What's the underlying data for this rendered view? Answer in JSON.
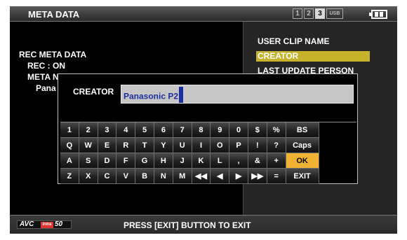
{
  "title": "META DATA",
  "slots": [
    "1",
    "2",
    "3",
    "USB"
  ],
  "left_panel": {
    "heading": "REC META DATA",
    "rec": "REC : ON",
    "meta_name": "META NAME :",
    "name_value": "Pana"
  },
  "right_panel": {
    "items": [
      "USER CLIP NAME",
      "CREATOR",
      "LAST UPDATE PERSON"
    ],
    "selected_index": 1
  },
  "dialog": {
    "label": "CREATOR",
    "value": "Panasonic P2",
    "keyboard": [
      [
        "1",
        "2",
        "3",
        "4",
        "5",
        "6",
        "7",
        "8",
        "9",
        "0",
        "$",
        "%",
        "BS"
      ],
      [
        "Q",
        "W",
        "E",
        "R",
        "T",
        "Y",
        "U",
        "I",
        "O",
        "P",
        "!",
        "?",
        "Caps"
      ],
      [
        "A",
        "S",
        "D",
        "F",
        "G",
        "H",
        "J",
        "K",
        "L",
        ",",
        "&",
        "+",
        "OK"
      ],
      [
        "Z",
        "X",
        "C",
        "V",
        "B",
        "N",
        "M",
        "◀◀",
        "◀",
        "▶",
        "▶▶",
        "=",
        "EXIT"
      ]
    ],
    "highlighted_key": "OK"
  },
  "status_bar": {
    "logo_avc": "AVC",
    "logo_intra": "Intra",
    "logo_num": "50",
    "message": "PRESS [EXIT] BUTTON TO EXIT"
  },
  "colors": {
    "selection": "#c6b22b",
    "ok_key": "#f0b232",
    "input_text": "#1c2fa0"
  },
  "battery_icon": "battery-icon"
}
